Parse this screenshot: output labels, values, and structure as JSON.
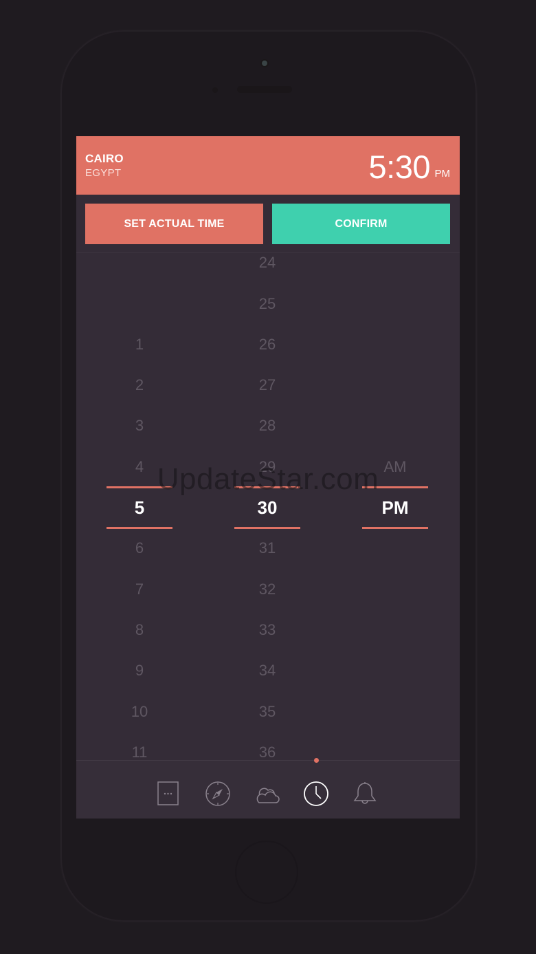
{
  "header": {
    "city": "CAIRO",
    "country": "EGYPT",
    "time": "5:30",
    "ampm": "PM"
  },
  "buttons": {
    "set_actual_time": "SET ACTUAL TIME",
    "confirm": "CONFIRM"
  },
  "picker": {
    "hours": [
      "1",
      "2",
      "3",
      "4",
      "5",
      "6",
      "7",
      "8",
      "9",
      "10",
      "11"
    ],
    "selected_hour": "5",
    "minutes": [
      "24",
      "25",
      "26",
      "27",
      "28",
      "29",
      "30",
      "31",
      "32",
      "33",
      "34",
      "35",
      "36"
    ],
    "selected_minute": "30",
    "periods": [
      "AM",
      "PM"
    ],
    "selected_period": "PM"
  },
  "watermark": "UpdateStar.com",
  "tabbar": {
    "items": [
      {
        "icon": "more-icon",
        "active": false
      },
      {
        "icon": "compass-icon",
        "active": false
      },
      {
        "icon": "weather-icon",
        "active": false
      },
      {
        "icon": "clock-icon",
        "active": true
      },
      {
        "icon": "bell-icon",
        "active": false
      }
    ]
  },
  "colors": {
    "accent": "#e07264",
    "confirm": "#3fd0ae",
    "background": "#342c37",
    "muted_text": "#5f5762"
  }
}
